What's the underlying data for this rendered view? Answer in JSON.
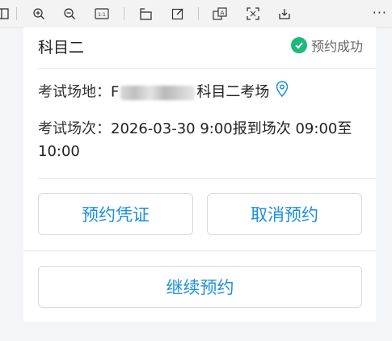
{
  "toolbar": {
    "icons": [
      "panel-icon",
      "zoom-in-icon",
      "zoom-out-icon",
      "actual-size-icon",
      "rotate-icon",
      "edit-icon",
      "translate-icon",
      "screenshot-icon",
      "save-icon"
    ],
    "more_label": "···"
  },
  "card": {
    "subject": "科目二",
    "status": "预约成功",
    "status_color": "#1db97a",
    "venue_label": "考试场地：",
    "venue_prefix": "F",
    "venue_suffix": "科目二考场",
    "session_label": "考试场次：",
    "session_value": "2026-03-30 9:00报到场次 09:00至",
    "session_value_2": "10:00",
    "btn_voucher": "预约凭证",
    "btn_cancel": "取消预约",
    "btn_continue": "继续预约",
    "accent": "#1e8ee0"
  }
}
